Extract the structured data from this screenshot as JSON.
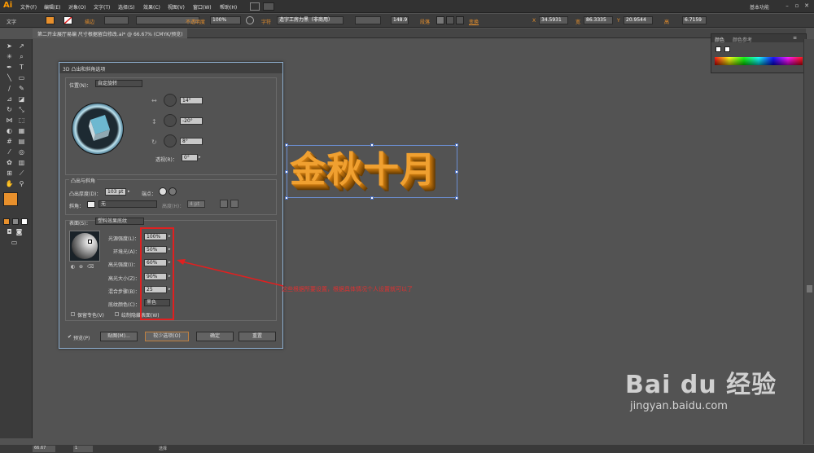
{
  "app": {
    "logo": "Ai",
    "workspace": "基本功能"
  },
  "menu": [
    "文件(F)",
    "编辑(E)",
    "对象(O)",
    "文字(T)",
    "选择(S)",
    "效果(C)",
    "视图(V)",
    "窗口(W)",
    "帮助(H)"
  ],
  "control": {
    "type_label": "文字",
    "stroke_label": "描边",
    "opacity_label": "不透明度",
    "opacity_value": "100%",
    "char_label": "字符",
    "font_name": "造字工房力黑（非商用）",
    "font_size": "148.9",
    "para_label": "段落",
    "x_value": "34.5931",
    "w_value": "86.3335",
    "y_value": "20.9544",
    "h_value": "6.7159"
  },
  "doc_tab": "第二开业展厅易编 尺寸根据留白修改.ai* @ 66.67% (CMYK/预览)",
  "dialog": {
    "title": "3D 凸出和斜角选项",
    "position_label": "位置(N)：",
    "position_value": "自定旋转",
    "rot_x": "14°",
    "rot_y": "-20°",
    "rot_z": "8°",
    "perspective_label": "透视(R)：",
    "perspective_value": "0°",
    "extrude_section": "凸出与斜角",
    "extrude_depth_label": "凸出厚度(D)：",
    "extrude_depth_value": "103 pt",
    "cap_label": "端点：",
    "bevel_label": "斜角：",
    "bevel_value": "无",
    "height_label": "高度(H)：",
    "height_value": "4 pt",
    "surface_label": "表面(S)：",
    "surface_value": "塑料效果底纹",
    "light_intensity_label": "光源强度(L)：",
    "light_intensity_value": "100%",
    "ambient_label": "环境光(A)：",
    "ambient_value": "50%",
    "highlight_intensity_label": "高光强度(I)：",
    "highlight_intensity_value": "60%",
    "highlight_size_label": "高光大小(Z)：",
    "highlight_size_value": "90%",
    "blend_steps_label": "混合步骤(B)：",
    "blend_steps_value": "25",
    "shading_color_label": "底纹颜色(C)：",
    "shading_color_value": "黑色",
    "preserve_spot": "保留专色(V)",
    "draw_hidden": "绘制隐藏表面(W)",
    "preview": "预览(P)",
    "map_btn": "贴图(M)...",
    "fewer_btn": "较少选项(O)",
    "ok_btn": "确定",
    "reset_btn": "重置"
  },
  "annotation": "这些根据所要设置，根据具体情况个人设置就可以了",
  "artwork_text": "金秋十月",
  "color_panel": {
    "tab1": "颜色",
    "tab2": "颜色参考"
  },
  "status": {
    "zoom": "66.67",
    "page": "1",
    "mode": "选择"
  },
  "watermark": {
    "brand": "Bai du 经验",
    "url": "jingyan.baidu.com"
  },
  "colors": {
    "accent": "#f0a030",
    "annotation": "#e03030"
  }
}
